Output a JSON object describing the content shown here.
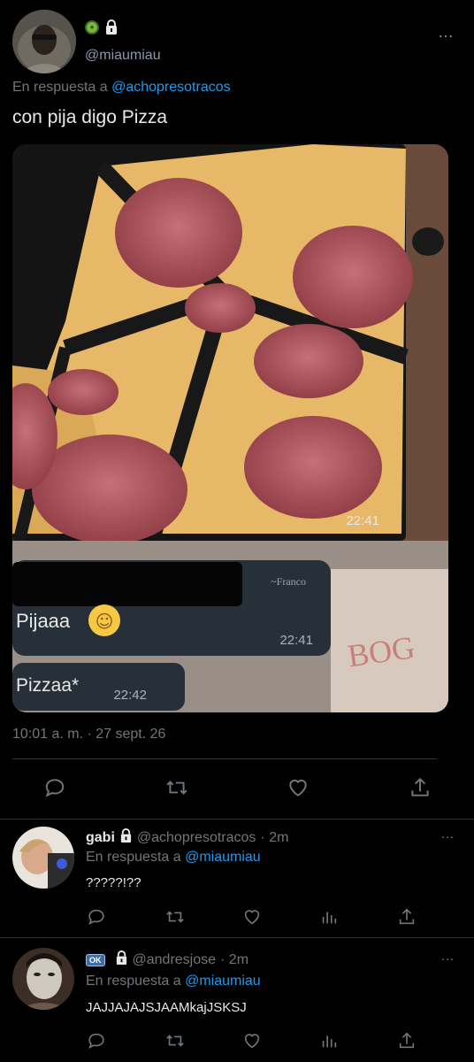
{
  "main_tweet": {
    "handle": "@miaumiau",
    "replying_prefix": "En respuesta a",
    "replying_to": "@achopresotracos",
    "text": "con pija digo Pizza",
    "timestamp": "10:01 a. m. · 27 sept. 26",
    "media": {
      "msg1_time": "22:41",
      "sender": "~Franco",
      "msg2_text": "Pijaaa",
      "msg2_emoji": "☺",
      "msg2_time": "22:41",
      "msg3_text": "Pizzaa*",
      "msg3_time": "22:42",
      "stamp_text": "BOG"
    },
    "more_icon": "…"
  },
  "replies": [
    {
      "name": "gabi",
      "handle": "@achopresotracos",
      "age": "· 2m",
      "replying_prefix": "En respuesta a",
      "replying_to": "@miaumiau",
      "text": "?????!??"
    },
    {
      "badge": "OK",
      "handle": "@andresjose",
      "age": "· 2m",
      "replying_prefix": "En respuesta a",
      "replying_to": "@miaumiau",
      "text": "JAJJAJAJSJAAMkajJSKSJ"
    }
  ],
  "colors": {
    "background": "#000000",
    "text": "#e7e9ea",
    "muted": "#71767b",
    "accent": "#1d9bf0",
    "divider": "#2f3336"
  },
  "icons": [
    "reply-icon",
    "retweet-icon",
    "like-icon",
    "share-icon",
    "analytics-icon",
    "lock-icon",
    "more-icon"
  ]
}
